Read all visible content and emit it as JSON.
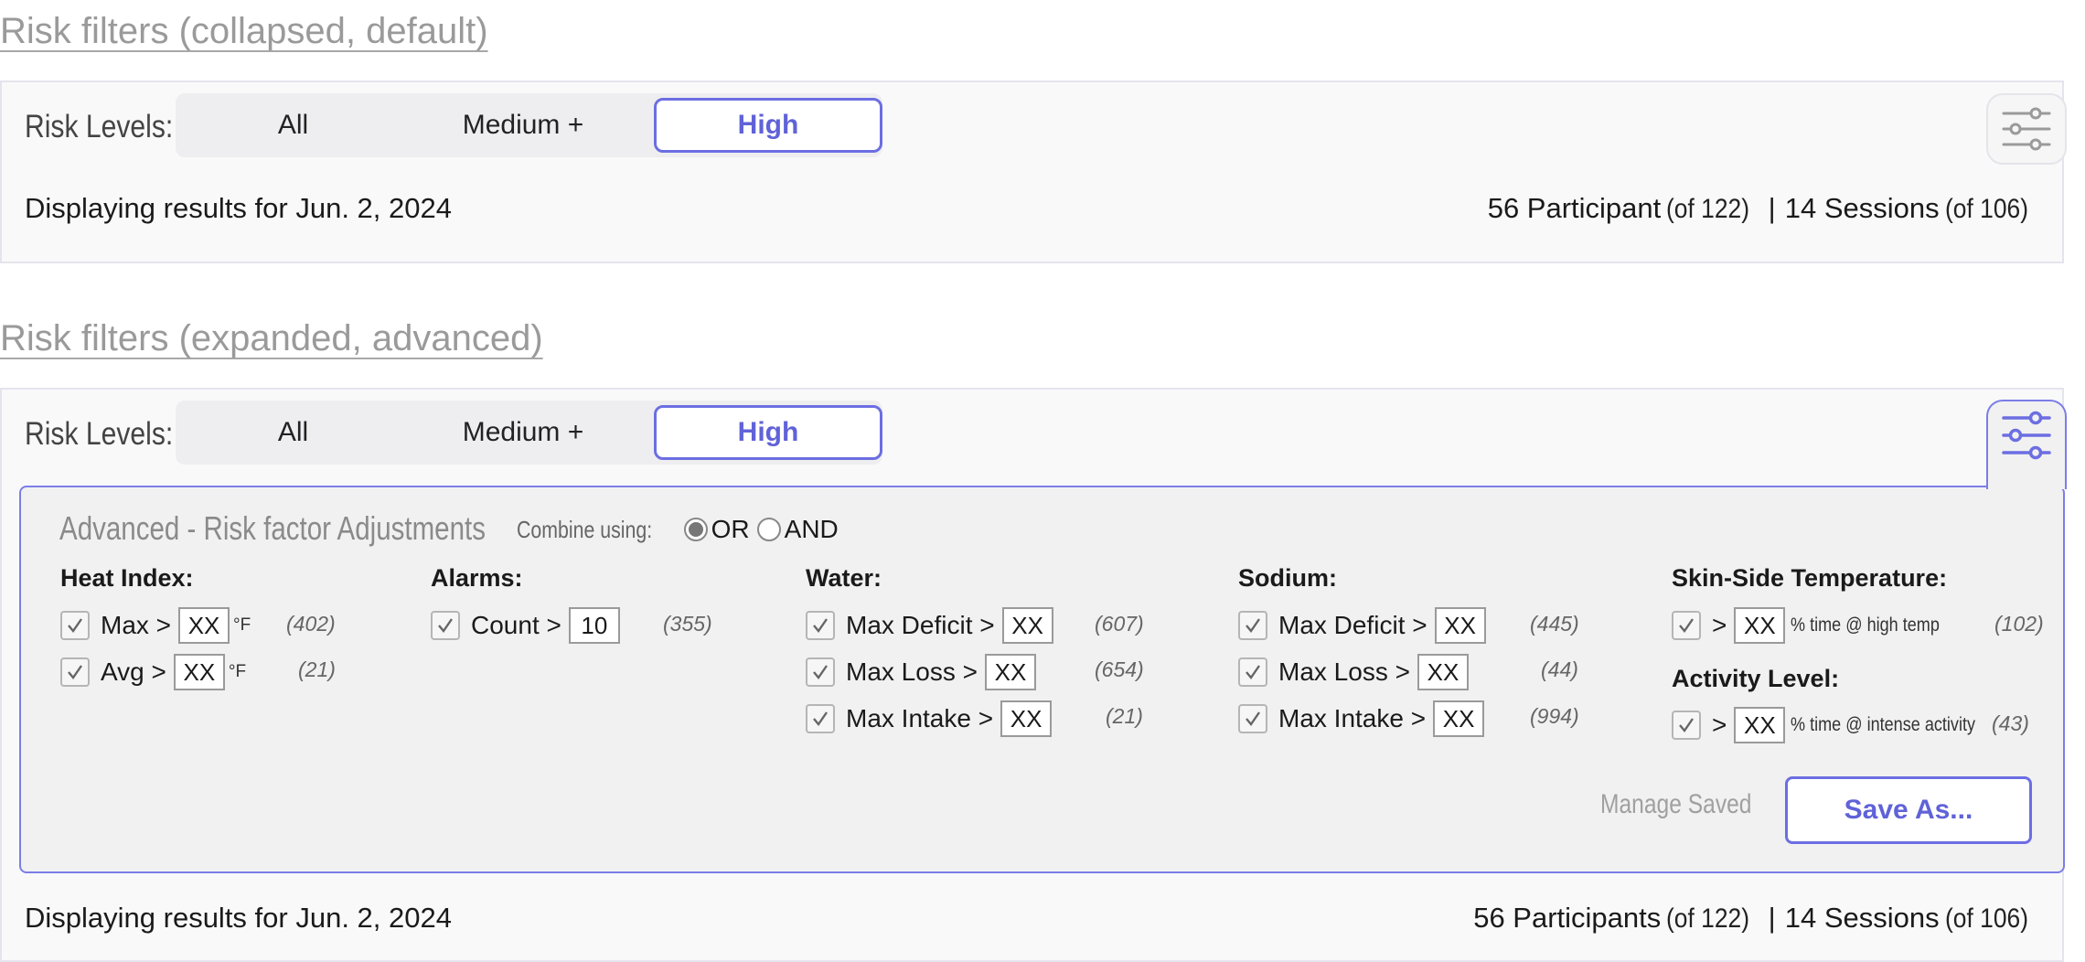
{
  "collapsed": {
    "section_title": "Risk filters (collapsed, default)",
    "risk_label": "Risk Levels:",
    "segments": [
      "All",
      "Medium +",
      "High"
    ],
    "selected_segment": "High",
    "display_text": "Displaying results for Jun. 2, 2024",
    "participants": "56 Participant",
    "participants_of": "(of 122)",
    "separator": "|",
    "sessions": "14 Sessions",
    "sessions_of": "(of 106)",
    "filter_icon": "sliders-icon"
  },
  "expanded": {
    "section_title": "Risk filters (expanded, advanced)",
    "risk_label": "Risk Levels:",
    "segments": [
      "All",
      "Medium +",
      "High"
    ],
    "selected_segment": "High",
    "filter_icon": "sliders-icon",
    "advanced": {
      "title": "Advanced - Risk factor Adjustments",
      "combine_label": "Combine using:",
      "options": [
        "OR",
        "AND"
      ],
      "selected": "OR",
      "heat_index": {
        "title": "Heat Index:",
        "rows": [
          {
            "label": "Max >",
            "value": "XX",
            "unit": "°F",
            "count": "(402)"
          },
          {
            "label": "Avg >",
            "value": "XX",
            "unit": "°F",
            "count": "(21)"
          }
        ]
      },
      "alarms": {
        "title": "Alarms:",
        "rows": [
          {
            "label": "Count >",
            "value": "10",
            "count": "(355)"
          }
        ]
      },
      "water": {
        "title": "Water:",
        "rows": [
          {
            "label": "Max Deficit >",
            "value": "XX",
            "count": "(607)"
          },
          {
            "label": "Max Loss >",
            "value": "XX",
            "count": "(654)"
          },
          {
            "label": "Max Intake >",
            "value": "XX",
            "count": "(21)"
          }
        ]
      },
      "sodium": {
        "title": "Sodium:",
        "rows": [
          {
            "label": "Max Deficit >",
            "value": "XX",
            "count": "(445)"
          },
          {
            "label": "Max Loss >",
            "value": "XX",
            "count": "(44)"
          },
          {
            "label": "Max Intake >",
            "value": "XX",
            "count": "(994)"
          }
        ]
      },
      "skin_temp": {
        "title": "Skin-Side Temperature:",
        "rows": [
          {
            "label": ">",
            "value": "XX",
            "suffix": "% time @ high temp",
            "count": "(102)"
          }
        ]
      },
      "activity": {
        "title": "Activity Level:",
        "rows": [
          {
            "label": ">",
            "value": "XX",
            "suffix": "% time @ intense activity",
            "count": "(43)"
          }
        ]
      },
      "manage_saved": "Manage Saved",
      "save_as": "Save As..."
    },
    "display_text": "Displaying results for Jun. 2, 2024",
    "participants": "56 Participants",
    "participants_of": "(of 122)",
    "separator": "|",
    "sessions": "14 Sessions",
    "sessions_of": "(of 106)"
  },
  "colors": {
    "accent": "#6c6ee2",
    "panel_bg": "#f9f9fa",
    "advanced_bg": "#f1f1f2",
    "muted_text": "#9a9a9a"
  }
}
